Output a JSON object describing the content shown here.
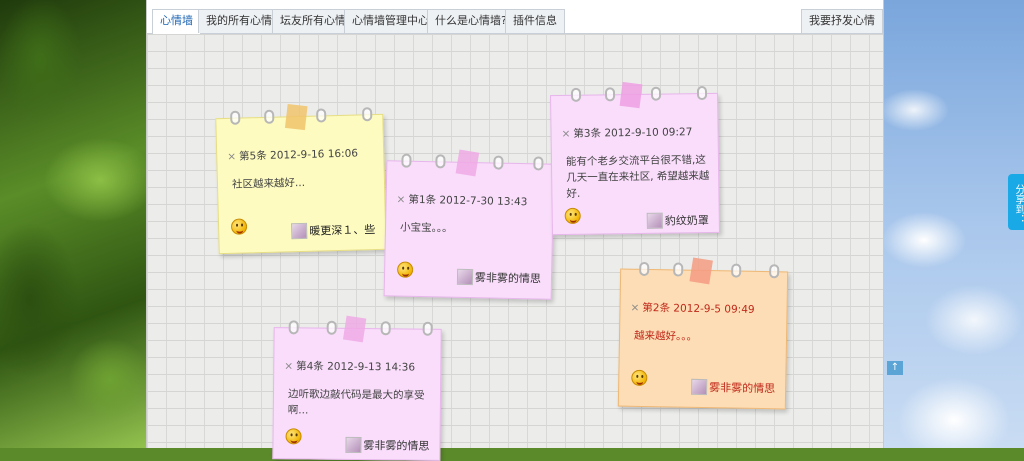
{
  "tabs": [
    {
      "label": "心情墙",
      "active": true
    },
    {
      "label": "我的所有心情",
      "active": false
    },
    {
      "label": "坛友所有心情",
      "active": false
    },
    {
      "label": "心情墙管理中心",
      "active": false
    },
    {
      "label": "什么是心情墙?",
      "active": false
    },
    {
      "label": "插件信息",
      "active": false
    }
  ],
  "post_button": "我要抒发心情",
  "notes": [
    {
      "color": "yellow",
      "close": "×",
      "meta": "第5条 2012-9-16 16:06",
      "content": "社区越来越好...",
      "author": "暖更深１、些",
      "author_color": "#222222"
    },
    {
      "color": "pink",
      "close": "×",
      "meta": "第1条 2012-7-30 13:43",
      "content": "小宝宝。。。",
      "author": "雾非雾的情思",
      "author_color": "#333333"
    },
    {
      "color": "pink",
      "close": "×",
      "meta": "第3条 2012-9-10 09:27",
      "content": "能有个老乡交流平台很不错,这几天一直在来社区, 希望越来越好.",
      "author": "豹纹奶罩",
      "author_color": "#333333"
    },
    {
      "color": "orange",
      "close": "×",
      "meta": "第2条 2012-9-5 09:49",
      "content": "越来越好。。。",
      "author": "雾非雾的情思",
      "author_color": "#c0281a"
    },
    {
      "color": "pink",
      "close": "×",
      "meta": "第4条 2012-9-13 14:36",
      "content": "边听歌边敲代码是最大的享受啊...",
      "author": "雾非雾的情思",
      "author_color": "#333333"
    }
  ],
  "share": "分享到：",
  "back_to_top": "↑",
  "colors": {
    "accent": "#1e66b3",
    "share": "#18a9e6",
    "red_text": "#c0281a"
  }
}
